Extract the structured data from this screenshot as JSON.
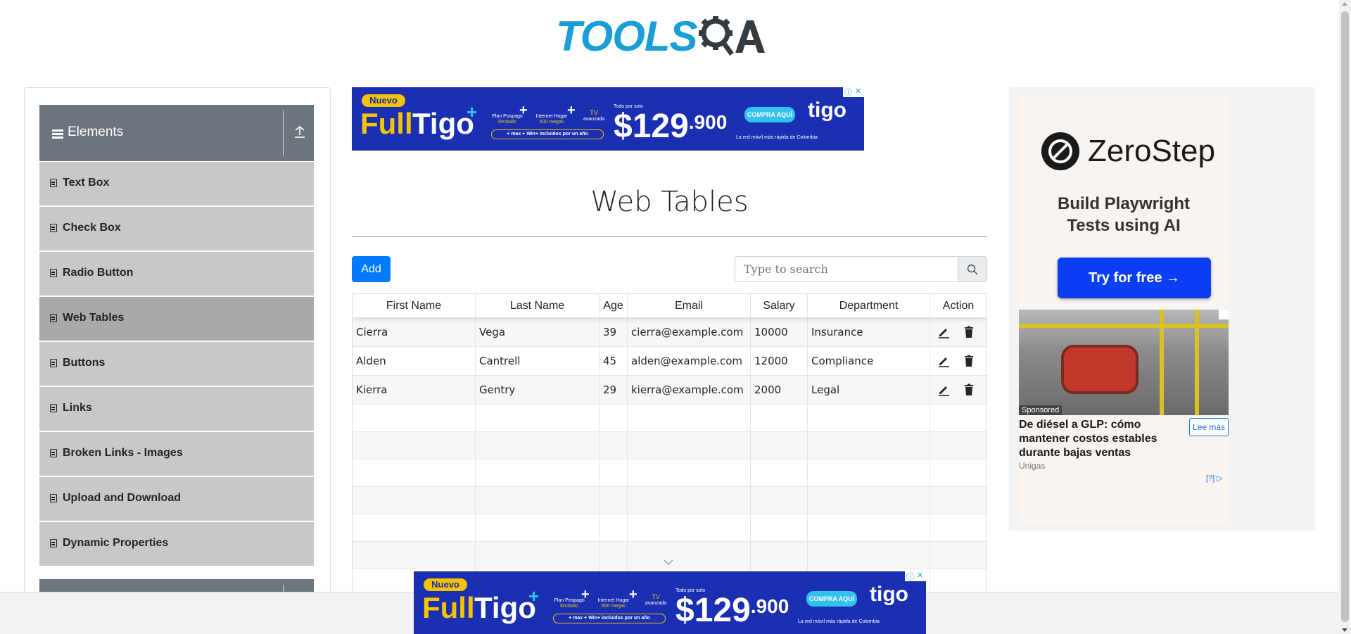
{
  "logo": {
    "main": "TOOLS",
    "accent": "QA"
  },
  "nav": {
    "group_title": "Elements",
    "items": [
      {
        "label": "Text Box",
        "active": false
      },
      {
        "label": "Check Box",
        "active": false
      },
      {
        "label": "Radio Button",
        "active": false
      },
      {
        "label": "Web Tables",
        "active": true
      },
      {
        "label": "Buttons",
        "active": false
      },
      {
        "label": "Links",
        "active": false
      },
      {
        "label": "Broken Links - Images",
        "active": false
      },
      {
        "label": "Upload and Download",
        "active": false
      },
      {
        "label": "Dynamic Properties",
        "active": false
      }
    ]
  },
  "banner_ad": {
    "badge": "Nuevo",
    "brand_full": "Full",
    "brand_tigo": "Tigo",
    "plus": "+",
    "feature1_line1": "Plan Pospago",
    "feature1_line2": "ilimitado",
    "feature2_line1": "Internet Hogar",
    "feature2_line2": "500 megas",
    "feature3_line1": "TV",
    "feature3_line2": "avanzada",
    "pill": "+ max + Win+ incluidos por un año",
    "todo": "Todo por solo",
    "price_main": "$129",
    "price_tail": ".900",
    "cta": "COMPRA AQUÍ",
    "logo": "tigo",
    "tagline": "La red móvil más rápida de Colombia"
  },
  "page": {
    "title": "Web Tables",
    "add_label": "Add",
    "search_placeholder": "Type to search"
  },
  "table": {
    "headers": [
      "First Name",
      "Last Name",
      "Age",
      "Email",
      "Salary",
      "Department",
      "Action"
    ],
    "rows": [
      [
        "Cierra",
        "Vega",
        "39",
        "cierra@example.com",
        "10000",
        "Insurance"
      ],
      [
        "Alden",
        "Cantrell",
        "45",
        "alden@example.com",
        "12000",
        "Compliance"
      ],
      [
        "Kierra",
        "Gentry",
        "29",
        "kierra@example.com",
        "2000",
        "Legal"
      ]
    ]
  },
  "right_ad": {
    "brand": "ZeroStep",
    "tagline_line1": "Build Playwright",
    "tagline_line2": "Tests using AI",
    "cta": "Try for free →",
    "sponsored": "Sponsored",
    "headline": "De diésel a GLP: cómo mantener costos estables durante bajas ventas",
    "read_more": "Lee más",
    "source": "Unigas",
    "adchoice": "[?]"
  },
  "colors": {
    "primary": "#007bff",
    "nav_header": "#6c757d",
    "nav_item": "#c8c8c8",
    "nav_active": "#a9a9a9",
    "logo_blue": "#1a9ed8",
    "ad_blue": "#1a2fb2"
  }
}
